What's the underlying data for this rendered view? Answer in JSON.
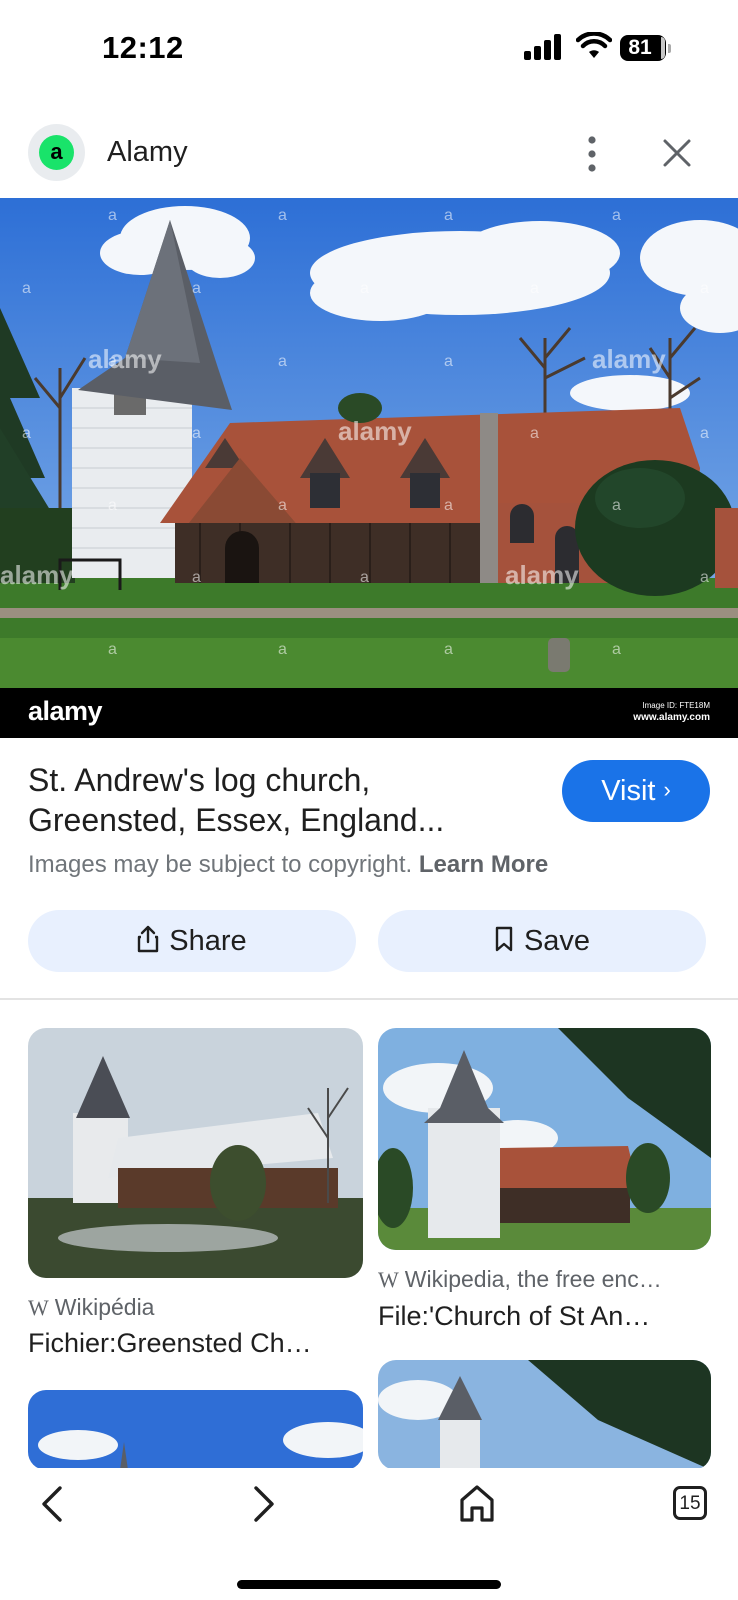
{
  "status_bar": {
    "time": "12:12",
    "battery": "81"
  },
  "header": {
    "site_name": "Alamy",
    "site_avatar_letter": "a"
  },
  "hero": {
    "watermark": "alamy",
    "image_id": "Image ID: FTE18M",
    "url": "www.alamy.com"
  },
  "result": {
    "title": "St. Andrew's log church, Greensted, Essex, England...",
    "visit_label": "Visit",
    "copyright": "Images may be subject to copyright.",
    "learn_more": "Learn More",
    "share_label": "Share",
    "save_label": "Save"
  },
  "related": [
    {
      "source": "Wikipédia",
      "caption": "Fichier:Greensted Ch…"
    },
    {
      "source": "Wikipedia, the free enc…",
      "caption": "File:'Church of St An…"
    }
  ],
  "bottom_nav": {
    "tabs_count": "15"
  },
  "colors": {
    "accent": "#1a73e8",
    "action_bg": "#e8f0fe",
    "alamy_green": "#19e36a"
  }
}
